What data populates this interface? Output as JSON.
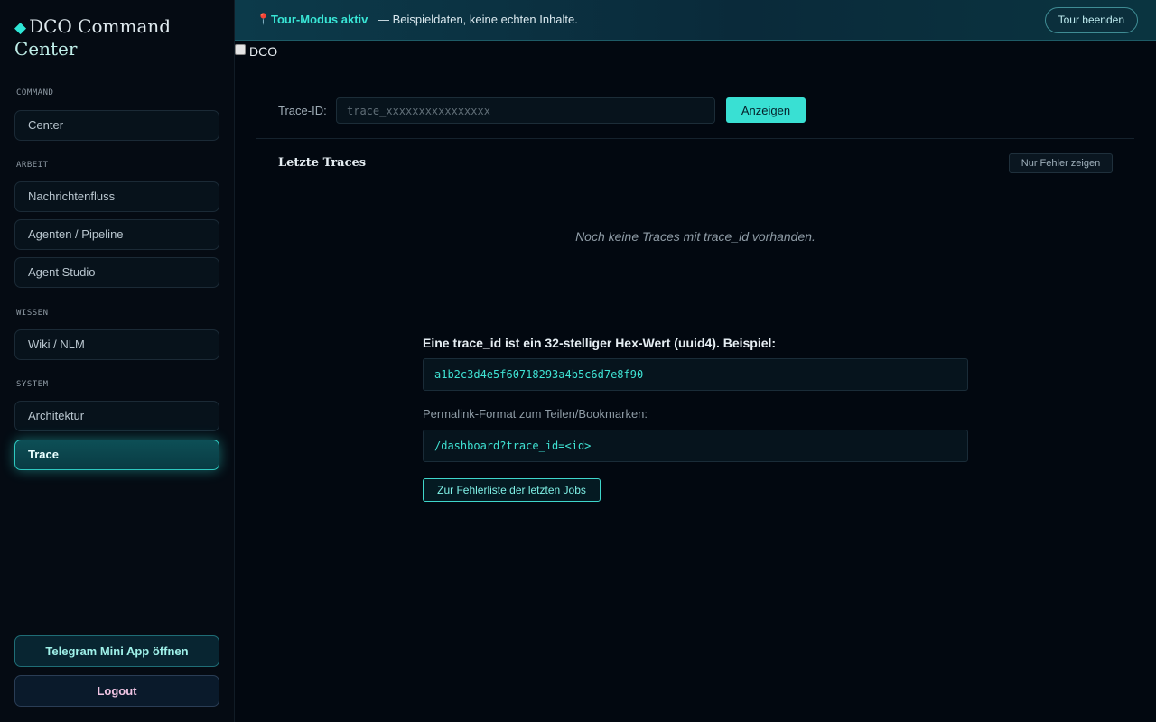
{
  "brand": {
    "icon": "diamond-icon",
    "line1": "DCO Command",
    "line2": "Center"
  },
  "sidebar": {
    "sections": [
      {
        "label": "COMMAND",
        "items": [
          {
            "label": "Center"
          }
        ]
      },
      {
        "label": "ARBEIT",
        "items": [
          {
            "label": "Nachrichtenfluss"
          },
          {
            "label": "Agenten / Pipeline"
          },
          {
            "label": "Agent Studio"
          }
        ]
      },
      {
        "label": "WISSEN",
        "items": [
          {
            "label": "Wiki / NLM"
          }
        ]
      },
      {
        "label": "SYSTEM",
        "items": [
          {
            "label": "Architektur"
          },
          {
            "label": "Trace",
            "active": true
          }
        ]
      }
    ],
    "telegram_label": "Telegram Mini App öffnen",
    "logout_label": "Logout"
  },
  "banner": {
    "icon": "pin-icon",
    "mode": "Tour-Modus aktiv",
    "description": "— Beispieldaten, keine echten Inhalte.",
    "end_label": "Tour beenden"
  },
  "dco_toggle": {
    "label": "DCO",
    "checked": false
  },
  "trace": {
    "label": "Trace-ID:",
    "placeholder": "trace_xxxxxxxxxxxxxxxx",
    "value": "",
    "show_label": "Anzeigen"
  },
  "recent": {
    "title": "Letzte Traces",
    "errors_only_label": "Nur Fehler zeigen",
    "empty_message": "Noch keine Traces mit trace_id vorhanden."
  },
  "help": {
    "title": "Eine trace_id ist ein 32-stelliger Hex-Wert (uuid4). Beispiel:",
    "example": "a1b2c3d4e5f60718293a4b5c6d7e8f90",
    "permalink_label": "Permalink-Format zum Teilen/Bookmarken:",
    "permalink_format": "/dashboard?trace_id=<id>",
    "joblist_label": "Zur Fehlerliste der letzten Jobs"
  },
  "colors": {
    "accent": "#39e0d3",
    "background": "#020810",
    "sidebar": "#050b13"
  }
}
